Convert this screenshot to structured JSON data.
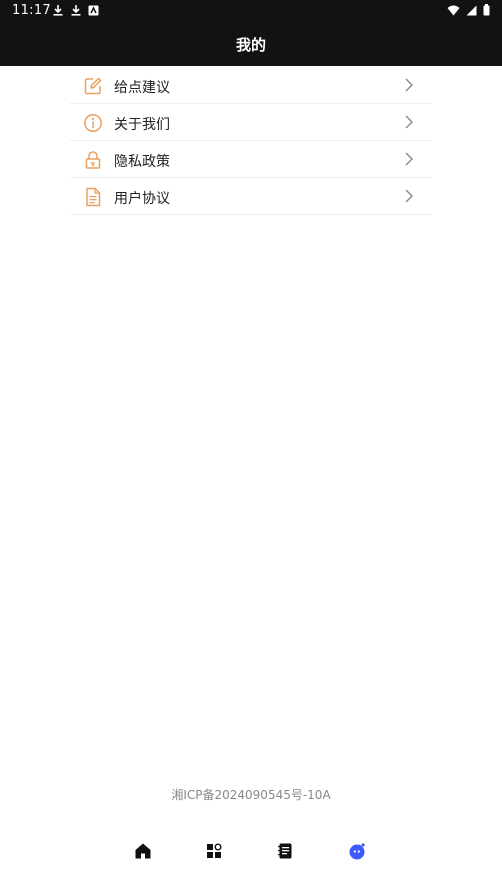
{
  "status_bar": {
    "time": "11:17",
    "left_icons": [
      "download-icon",
      "download-icon",
      "app-notification-icon"
    ],
    "right_icons": [
      "wifi-icon",
      "signal-icon",
      "battery-icon"
    ]
  },
  "header": {
    "title": "我的"
  },
  "menu": {
    "items": [
      {
        "label": "给点建议",
        "icon": "edit-icon"
      },
      {
        "label": "关于我们",
        "icon": "info-icon"
      },
      {
        "label": "隐私政策",
        "icon": "lock-icon"
      },
      {
        "label": "用户协议",
        "icon": "document-icon"
      }
    ]
  },
  "footer": {
    "icp": "湘ICP备2024090545号-10A"
  },
  "bottom_nav": {
    "items": [
      {
        "icon": "home-icon",
        "active": false
      },
      {
        "icon": "apps-icon",
        "active": false
      },
      {
        "icon": "notes-icon",
        "active": false
      },
      {
        "icon": "profile-icon",
        "active": true
      }
    ]
  },
  "colors": {
    "header_bg": "#121212",
    "accent_orange": "#E8A062",
    "active_nav": "#3D5AFE",
    "text_primary": "#222222",
    "footer_text": "#888888"
  }
}
